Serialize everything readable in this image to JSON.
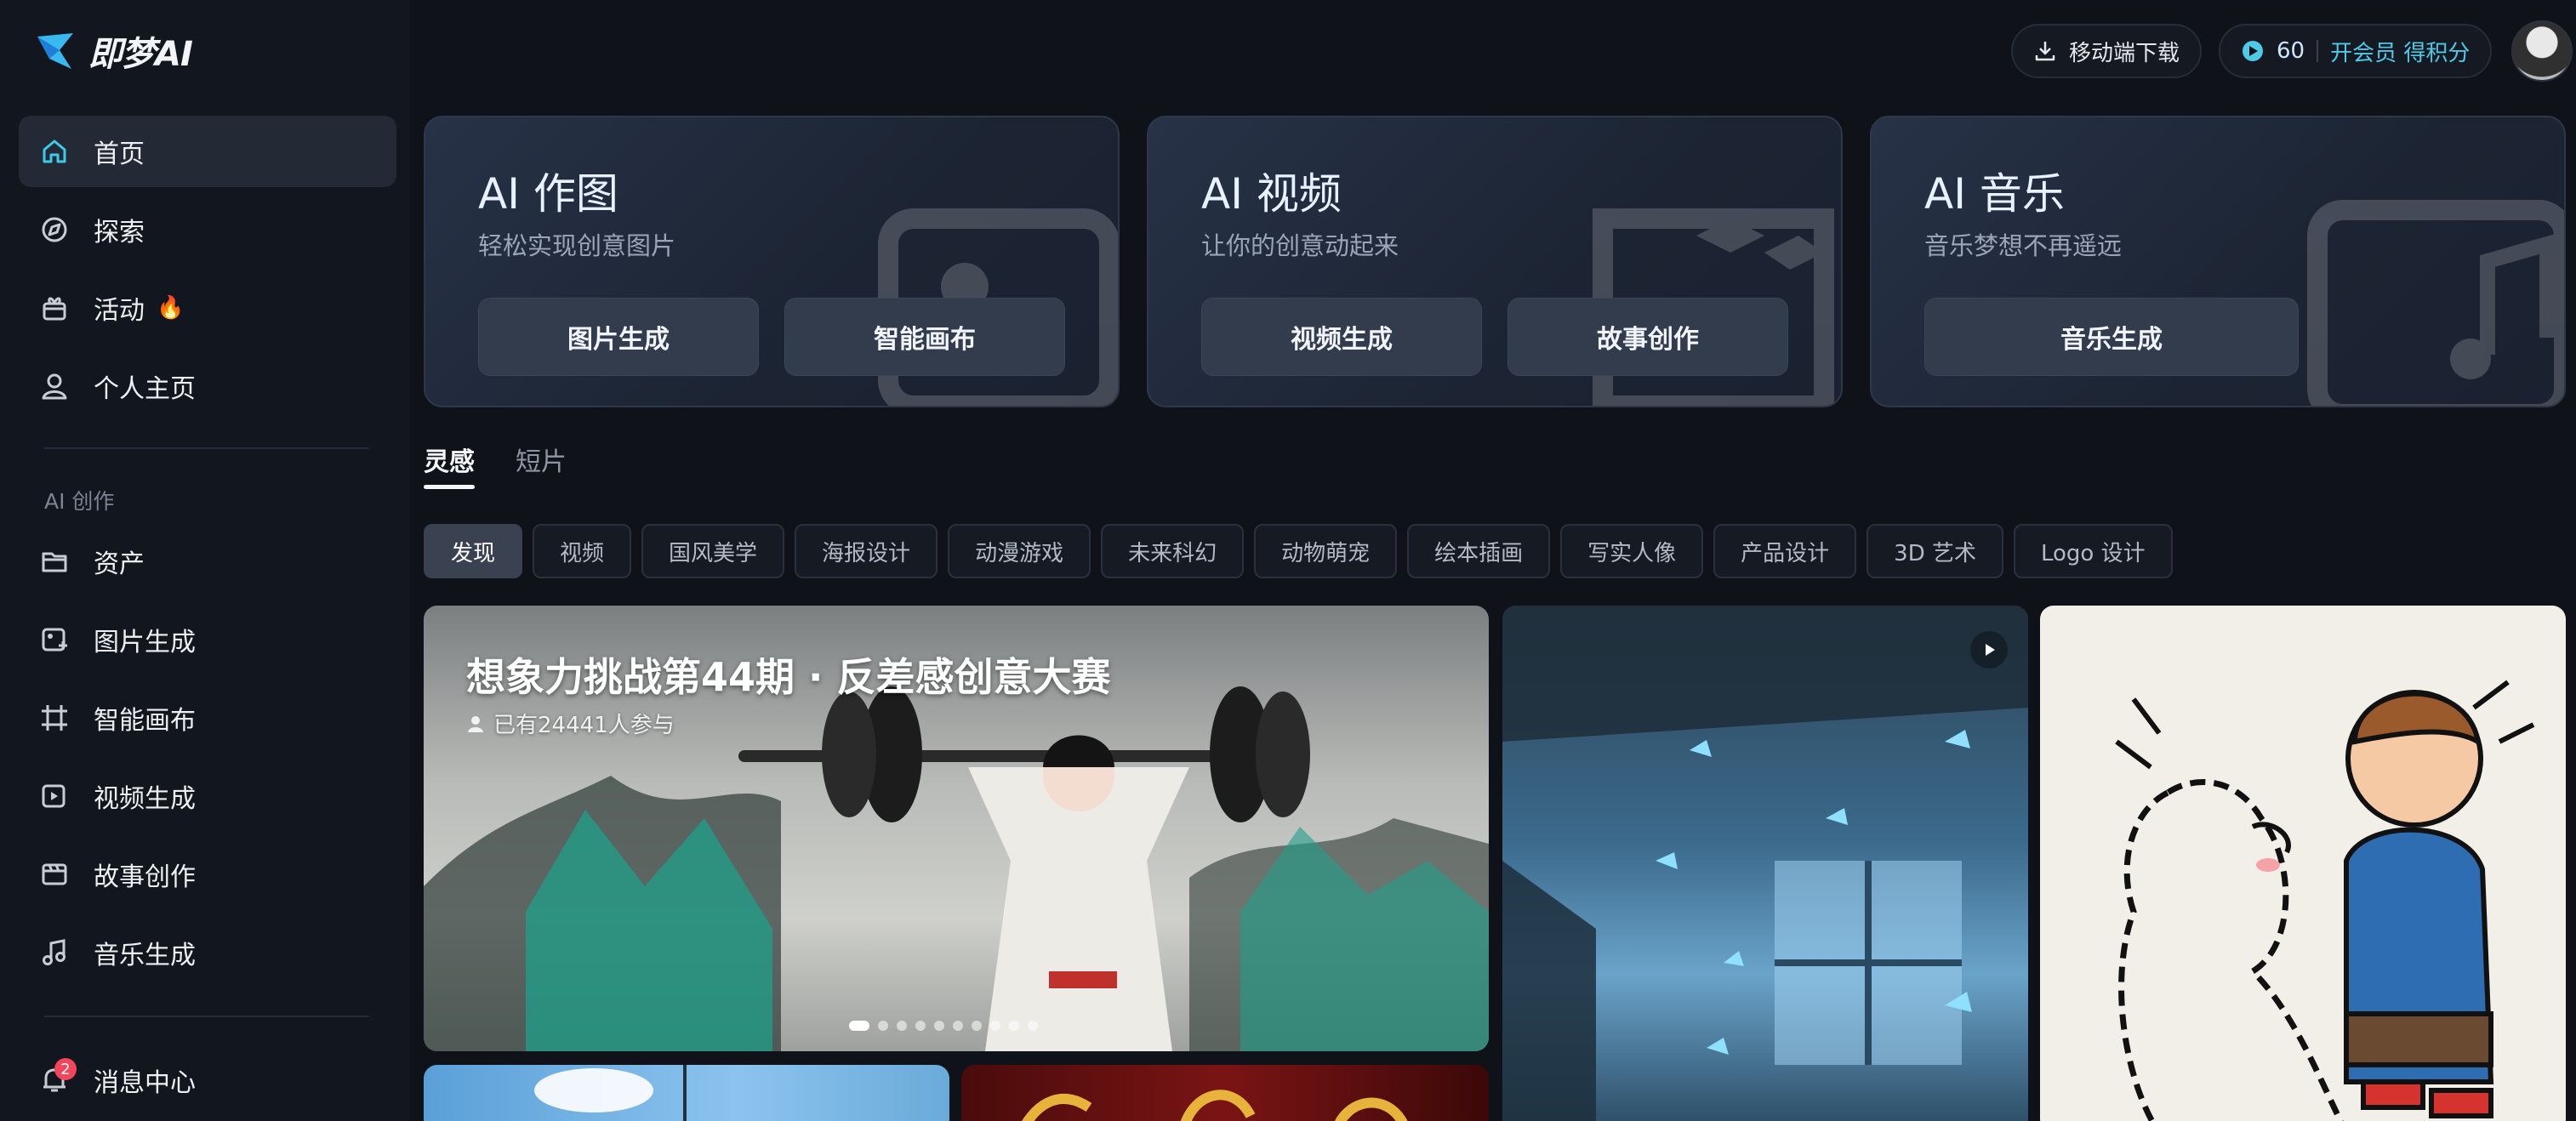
{
  "app": {
    "logo_text": "即梦AI"
  },
  "sidebar": {
    "nav": [
      {
        "label": "首页",
        "icon": "home-icon"
      },
      {
        "label": "探索",
        "icon": "compass-icon"
      },
      {
        "label": "活动",
        "icon": "gift-icon",
        "flame": "🔥"
      },
      {
        "label": "个人主页",
        "icon": "user-icon"
      }
    ],
    "section_title": "AI 创作",
    "tools": [
      {
        "label": "资产",
        "icon": "folder-icon"
      },
      {
        "label": "图片生成",
        "icon": "image-generate-icon"
      },
      {
        "label": "智能画布",
        "icon": "canvas-icon"
      },
      {
        "label": "视频生成",
        "icon": "video-generate-icon"
      },
      {
        "label": "故事创作",
        "icon": "story-icon"
      },
      {
        "label": "音乐生成",
        "icon": "music-icon"
      }
    ],
    "messages": {
      "label": "消息中心",
      "badge": "2"
    }
  },
  "topbar": {
    "download_label": "移动端下载",
    "credits": "60",
    "vip_label": "开会员 得积分"
  },
  "cards": [
    {
      "title": "AI 作图",
      "subtitle": "轻松实现创意图片",
      "buttons": [
        "图片生成",
        "智能画布"
      ]
    },
    {
      "title": "AI 视频",
      "subtitle": "让你的创意动起来",
      "buttons": [
        "视频生成",
        "故事创作"
      ]
    },
    {
      "title": "AI 音乐",
      "subtitle": "音乐梦想不再遥远",
      "buttons": [
        "音乐生成"
      ]
    }
  ],
  "tabs": [
    "灵感",
    "短片"
  ],
  "categories": [
    "发现",
    "视频",
    "国风美学",
    "海报设计",
    "动漫游戏",
    "未来科幻",
    "动物萌宠",
    "绘本插画",
    "写实人像",
    "产品设计",
    "3D 艺术",
    "Logo 设计"
  ],
  "banner": {
    "title": "想象力挑战第44期 · 反差感创意大赛",
    "participants": "已有24441人参与",
    "slide_count": 10,
    "active_slide": 1
  },
  "colors": {
    "accent": "#4fc9e6",
    "badge": "#f5455c",
    "flame": "#ff7a2e"
  }
}
